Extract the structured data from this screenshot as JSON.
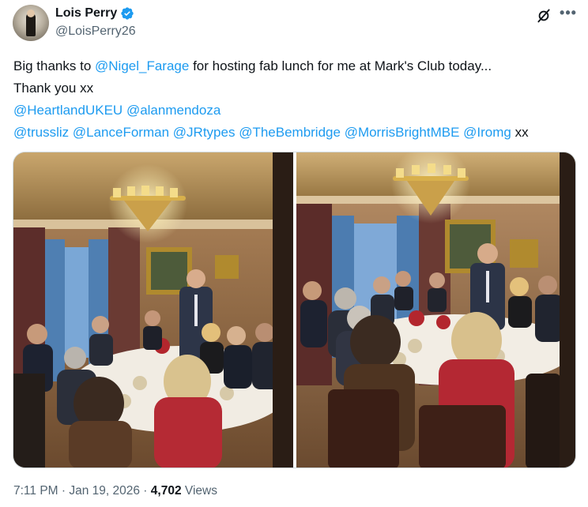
{
  "author": {
    "display_name": "Lois Perry",
    "handle": "@LoisPerry26"
  },
  "tweet": {
    "line1_prefix": "Big thanks to ",
    "line1_mention": "@Nigel_Farage",
    "line1_suffix": " for hosting fab lunch for me at Mark's Club today...",
    "line2": "Thank you xx",
    "mentions_row1": [
      "@HeartlandUKEU",
      "@alanmendoza"
    ],
    "mentions_row2": [
      "@trussliz",
      "@LanceForman",
      "@JRtypes",
      "@TheBembridge",
      "@MorrisBrightMBE",
      "@Iromg"
    ],
    "row2_suffix": " xx"
  },
  "meta": {
    "time": "7:11 PM",
    "sep1": " · ",
    "date": "Jan 19, 2026",
    "sep2": " · ",
    "views_count": "4,702",
    "views_label": " Views"
  },
  "colors": {
    "link": "#1d9bf0",
    "text": "#0f1419",
    "secondary": "#536471",
    "verified": "#1d9bf0"
  },
  "icons": [
    "verified-badge-icon",
    "grok-icon",
    "more-icon"
  ]
}
